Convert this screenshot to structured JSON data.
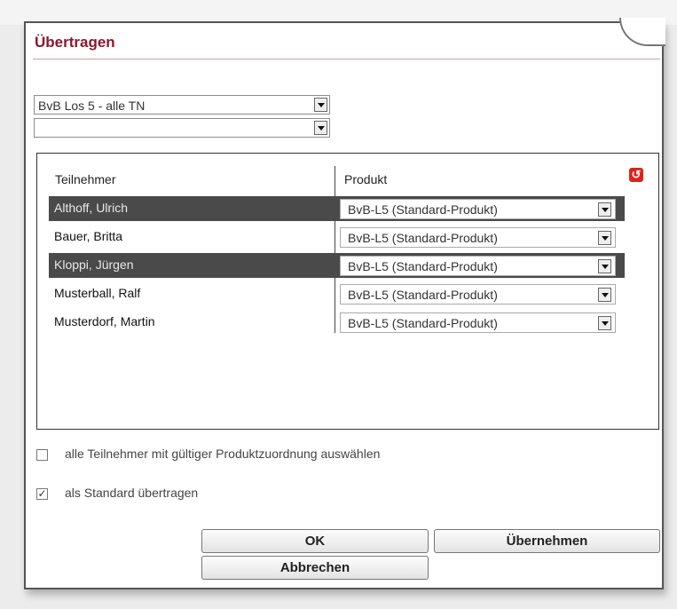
{
  "dialog": {
    "title": "Übertragen"
  },
  "filters": {
    "group_select": "BvB Los 5 - alle TN",
    "second_select": ""
  },
  "table": {
    "headers": {
      "participant": "Teilnehmer",
      "product": "Produkt"
    },
    "reset_icon": "undo-icon",
    "rows": [
      {
        "name": "Althoff, Ulrich",
        "product": "BvB-L5 (Standard-Produkt)",
        "selected": true
      },
      {
        "name": "Bauer, Britta",
        "product": "BvB-L5 (Standard-Produkt)",
        "selected": false
      },
      {
        "name": "Kloppi, Jürgen",
        "product": "BvB-L5 (Standard-Produkt)",
        "selected": true
      },
      {
        "name": "Musterball, Ralf",
        "product": "BvB-L5 (Standard-Produkt)",
        "selected": false
      },
      {
        "name": "Musterdorf, Martin",
        "product": "BvB-L5 (Standard-Produkt)",
        "selected": false
      }
    ]
  },
  "options": {
    "select_all_label": "alle Teilnehmer mit gültiger Produktzuordnung auswählen",
    "select_all_checked": false,
    "as_standard_label": "als Standard übertragen",
    "as_standard_checked": true
  },
  "buttons": {
    "ok": "OK",
    "apply": "Übernehmen",
    "cancel": "Abbrechen"
  },
  "colors": {
    "title": "#8a1730",
    "selected_row": "#4a4a4a",
    "reset_icon": "#e0221d"
  }
}
